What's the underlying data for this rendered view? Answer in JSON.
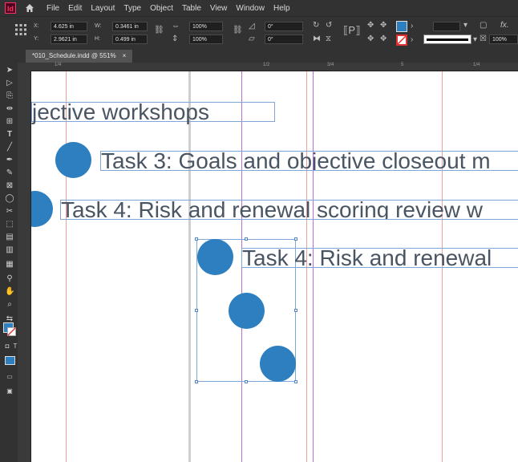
{
  "menu": {
    "app_badge": "Id",
    "items": [
      "File",
      "Edit",
      "Layout",
      "Type",
      "Object",
      "Table",
      "View",
      "Window",
      "Help"
    ]
  },
  "control_panel": {
    "x_label": "X:",
    "x_value": "4.625 in",
    "y_label": "Y:",
    "y_value": "2.9621 in",
    "w_label": "W:",
    "w_value": "0.3461 in",
    "h_label": "H:",
    "h_value": "0.499 in",
    "scale_x": "100%",
    "scale_y": "100%",
    "rotate": "0°",
    "shear": "0°",
    "opacity": "100%"
  },
  "document_tab": {
    "label": "*010_Schedule.indd @ 551%",
    "close": "×"
  },
  "ruler": {
    "ticks": [
      "1/4",
      "1/2",
      "3/4",
      "5",
      "1/4"
    ]
  },
  "canvas": {
    "line1": "jective workshops",
    "line2": "Task 3: Goals and objective closeout m",
    "line3": "Task 4: Risk and renewal scoring review w",
    "line4": "Task 4: Risk and renewal"
  },
  "colors": {
    "accent_fill": "#2e7fc0",
    "frame_edge": "#7fa6d6",
    "guide_magenta": "#c06bd6",
    "guide_red": "#f0a0a0"
  }
}
